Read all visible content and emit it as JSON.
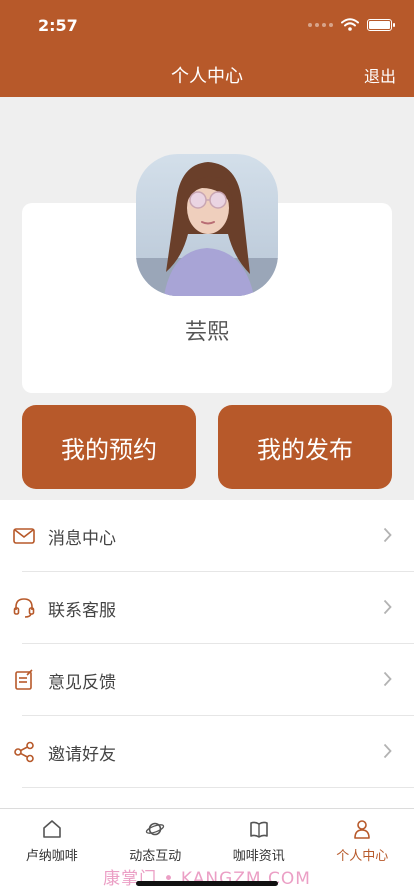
{
  "status_bar": {
    "time": "2:57"
  },
  "header": {
    "title": "个人中心",
    "logout_label": "退出"
  },
  "profile": {
    "name": "芸熙"
  },
  "actions": {
    "appointments_label": "我的预约",
    "posts_label": "我的发布"
  },
  "menu": [
    {
      "label": "消息中心",
      "icon": "envelope-icon"
    },
    {
      "label": "联系客服",
      "icon": "headset-icon"
    },
    {
      "label": "意见反馈",
      "icon": "feedback-icon"
    },
    {
      "label": "邀请好友",
      "icon": "share-icon"
    }
  ],
  "tabs": [
    {
      "label": "卢纳咖啡",
      "icon": "home-icon",
      "active": false
    },
    {
      "label": "动态互动",
      "icon": "planet-icon",
      "active": false
    },
    {
      "label": "咖啡资讯",
      "icon": "book-icon",
      "active": false
    },
    {
      "label": "个人中心",
      "icon": "person-icon",
      "active": true
    }
  ],
  "watermark": "康掌门 • KANGZM.COM",
  "colors": {
    "brand": "#b7592a",
    "background": "#efefef",
    "active_tab": "#b7592a"
  }
}
